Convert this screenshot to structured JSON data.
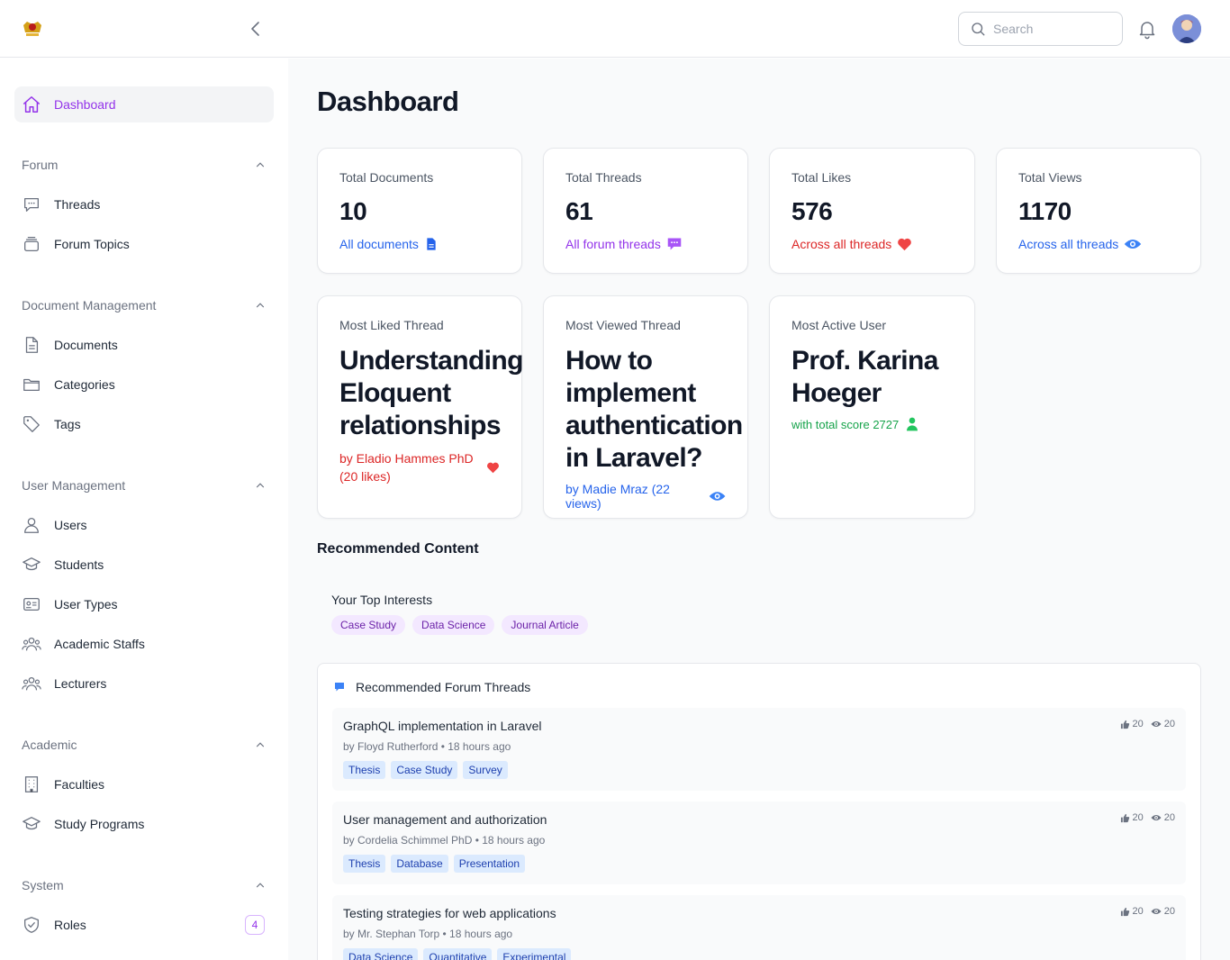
{
  "header": {
    "search_placeholder": "Search"
  },
  "sidebar": {
    "dashboard": "Dashboard",
    "groups": [
      {
        "title": "Forum",
        "items": [
          "Threads",
          "Forum Topics"
        ]
      },
      {
        "title": "Document Management",
        "items": [
          "Documents",
          "Categories",
          "Tags"
        ]
      },
      {
        "title": "User Management",
        "items": [
          "Users",
          "Students",
          "User Types",
          "Academic Staffs",
          "Lecturers"
        ]
      },
      {
        "title": "Academic",
        "items": [
          "Faculties",
          "Study Programs"
        ]
      },
      {
        "title": "System",
        "items": [
          "Roles"
        ]
      }
    ],
    "roles_badge": "4"
  },
  "page": {
    "title": "Dashboard"
  },
  "stats": [
    {
      "label": "Total Documents",
      "value": "10",
      "link": "All documents",
      "color": "#2563eb"
    },
    {
      "label": "Total Threads",
      "value": "61",
      "link": "All forum threads",
      "color": "#9333ea"
    },
    {
      "label": "Total Likes",
      "value": "576",
      "link": "Across all threads",
      "color": "#dc2626"
    },
    {
      "label": "Total Views",
      "value": "1170",
      "link": "Across all threads",
      "color": "#2563eb"
    }
  ],
  "highlights": {
    "liked": {
      "label": "Most Liked Thread",
      "title": "Understanding Eloquent relationships",
      "sub": "by Eladio Hammes PhD (20 likes)"
    },
    "viewed": {
      "label": "Most Viewed Thread",
      "title": "How to implement authentication in Laravel?",
      "sub": "by Madie Mraz (22 views)"
    },
    "active": {
      "label": "Most Active User",
      "title": "Prof. Karina Hoeger",
      "sub": "with total score 2727"
    }
  },
  "recommended": {
    "section_title": "Recommended Content",
    "interests_label": "Your Top Interests",
    "interests": [
      "Case Study",
      "Data Science",
      "Journal Article"
    ],
    "threads_title": "Recommended Forum Threads",
    "threads": [
      {
        "title": "GraphQL implementation in Laravel",
        "meta": "by Floyd Rutherford • 18 hours ago",
        "tags": [
          "Thesis",
          "Case Study",
          "Survey"
        ],
        "likes": "20",
        "views": "20"
      },
      {
        "title": "User management and authorization",
        "meta": "by Cordelia Schimmel PhD • 18 hours ago",
        "tags": [
          "Thesis",
          "Database",
          "Presentation"
        ],
        "likes": "20",
        "views": "20"
      },
      {
        "title": "Testing strategies for web applications",
        "meta": "by Mr. Stephan Torp • 18 hours ago",
        "tags": [
          "Data Science",
          "Quantitative",
          "Experimental"
        ],
        "likes": "20",
        "views": "20"
      }
    ]
  },
  "colors": {
    "accent": "#9333ea",
    "like": "#dc2626",
    "view": "#2563eb",
    "user": "#16a34a"
  }
}
